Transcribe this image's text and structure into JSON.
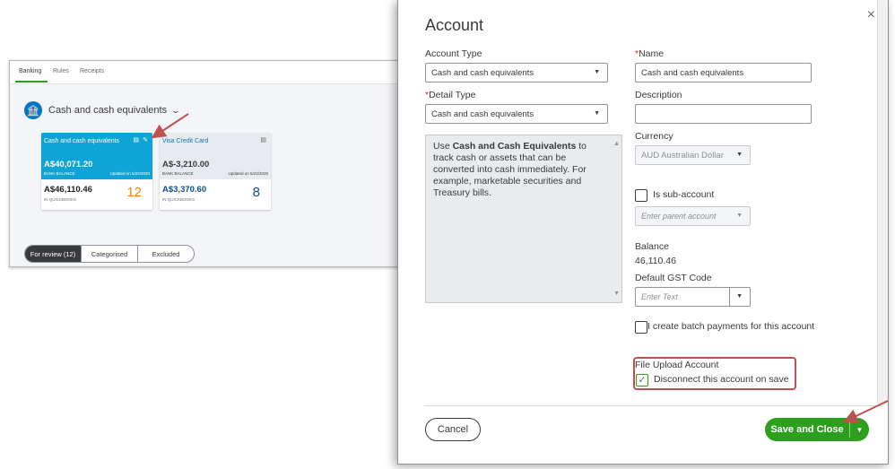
{
  "background": {
    "tabs": [
      "Banking",
      "Rules",
      "Receipts"
    ],
    "account_selector": "Cash and cash equivalents",
    "cards": [
      {
        "name": "Cash and cash equivalents",
        "bank_balance": "A$40,071.20",
        "bank_balance_label": "BANK BALANCE",
        "updated": "Updated on 5/22/2020",
        "qb_balance": "A$46,110.46",
        "qb_label": "IN QUICKBOOKS",
        "count": "12"
      },
      {
        "name": "Visa Credit Card",
        "bank_balance": "A$-3,210.00",
        "bank_balance_label": "BANK BALANCE",
        "updated": "Updated on 5/22/2020",
        "qb_balance": "A$3,370.60",
        "qb_label": "IN QUICKBOOKS",
        "count": "8"
      }
    ],
    "segments": [
      "For review (12)",
      "Categorised",
      "Excluded"
    ]
  },
  "modal": {
    "title": "Account",
    "close": "×",
    "account_type_label": "Account Type",
    "account_type_value": "Cash and cash equivalents",
    "detail_type_label": "Detail Type",
    "detail_type_value": "Cash and cash equivalents",
    "required_mark": "*",
    "description_pre": "Use ",
    "description_bold": "Cash and Cash Equivalents",
    "description_post": " to track cash or assets that can be converted into cash immediately. For example, marketable securities and Treasury bills.",
    "name_label": "Name",
    "name_value": "Cash and cash equivalents",
    "description_label": "Description",
    "description_value": "",
    "currency_label": "Currency",
    "currency_value": "AUD Australian Dollar",
    "sub_account_label": "Is sub-account",
    "parent_placeholder": "Enter parent account",
    "balance_label": "Balance",
    "balance_value": "46,110.46",
    "gst_label": "Default GST Code",
    "gst_placeholder": "Enter Text",
    "batch_label": "I create batch payments for this account",
    "file_upload_label": "File Upload Account",
    "disconnect_label": "Disconnect this account on save",
    "disconnect_checked": true,
    "cancel_label": "Cancel",
    "save_label": "Save and Close"
  },
  "colors": {
    "accent_green": "#2ca01c",
    "card_blue": "#0ea4d6",
    "annotation_red": "#c0504d"
  }
}
